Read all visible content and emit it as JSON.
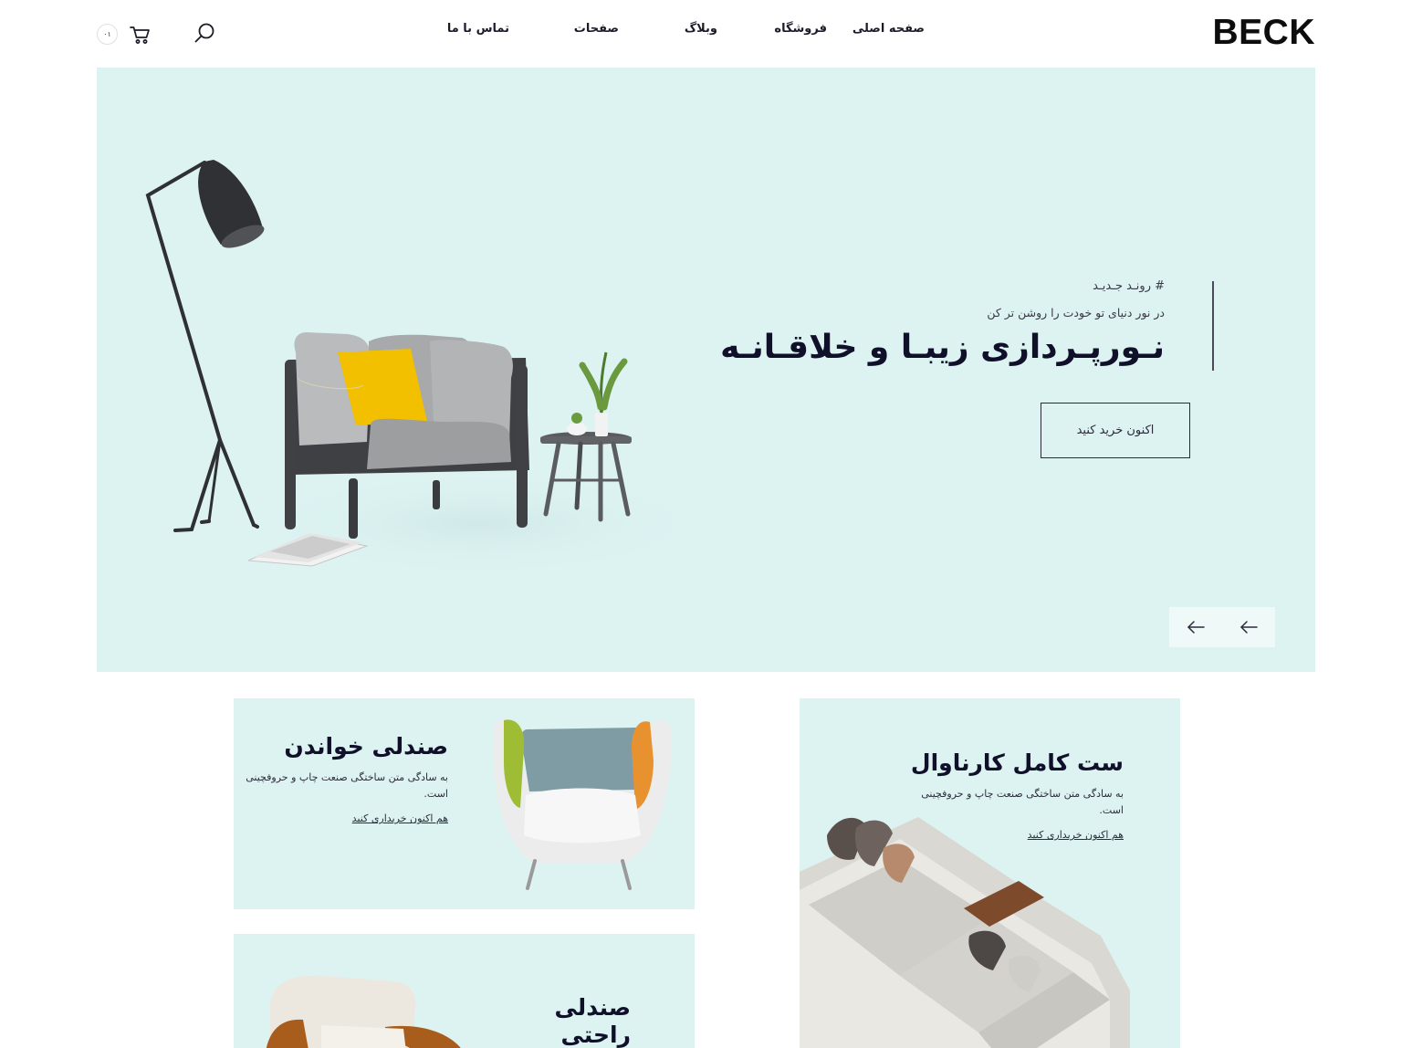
{
  "header": {
    "logo": "BECK",
    "nav": [
      "صفحه اصلی",
      "فروشگاه",
      "وبلاگ",
      "صفحات",
      "تماس با ما"
    ],
    "cart_count": "۰۱",
    "icons": [
      "search-icon",
      "cart-icon"
    ]
  },
  "hero": {
    "tag": "# رونـد جـدیـد",
    "subtitle": "در نور دنیای تو خودت را روشن تر کن",
    "title": "نـورپـردازی زیبـا و خلاقـانـه",
    "button": "اکنون خرید کنید",
    "controls": [
      "arrow-left-icon",
      "arrow-left-icon"
    ],
    "bg_color": "#dcf3f2"
  },
  "cards": [
    {
      "title": "صندلی خواندن",
      "desc": "به سادگی متن ساختگی صنعت چاپ و حروفچینی است.",
      "link": "هم اکنون خریداری کنید"
    },
    {
      "title": "ست کامل کارناوال",
      "desc": "به سادگی متن ساختگی صنعت چاپ و حروفچینی است.",
      "link": "هم اکنون خریداری کنید"
    },
    {
      "title": "صندلی راحتی"
    }
  ]
}
